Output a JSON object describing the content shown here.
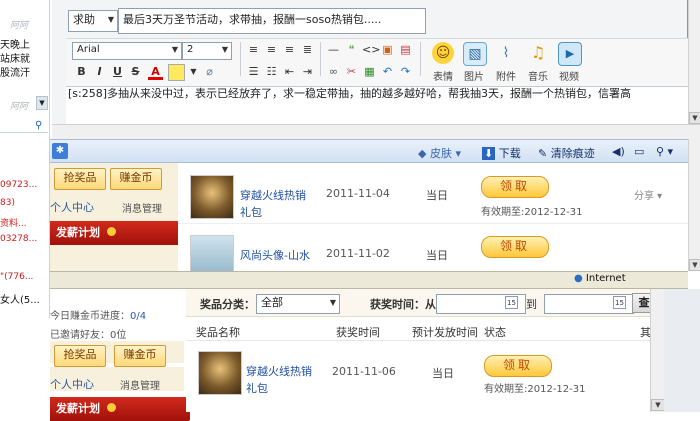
{
  "left_strip": {
    "lines_top": [
      "天晚上",
      "站床就",
      "股流汗"
    ],
    "faded_top": "阿阿",
    "faded_mid": "阿阿",
    "red_lines": [
      "09723...",
      "83)",
      "资料...",
      "03278...",
      "\"(776...",
      "女人(5..."
    ],
    "black_line": "女人(5..."
  },
  "editor": {
    "category_select": "求助",
    "subject": "最后3天万圣节活动，求带抽，报酬一soso热销包.....",
    "font_family": "Arial",
    "font_size": "2",
    "big_buttons": [
      {
        "icon": "smiley-icon",
        "label": "表情"
      },
      {
        "icon": "image-icon",
        "label": "图片"
      },
      {
        "icon": "attachment-icon",
        "label": "附件"
      },
      {
        "icon": "music-icon",
        "label": "音乐"
      },
      {
        "icon": "video-icon",
        "label": "视频"
      }
    ],
    "body_text": "[s:258]多抽从来没中过，表示已经放弃了，求一稳定带抽，抽的越多越好哈，帮我抽3天，报酬一个热销包，信署高"
  },
  "ie_toolbar": {
    "skin": "皮肤",
    "download": "下载",
    "clear_history": "清除痕迹"
  },
  "status_bar": {
    "zone": "Internet"
  },
  "middle_page": {
    "side_buttons": [
      "抢奖品",
      "赚金币"
    ],
    "personal_center": "个人中心",
    "message_manage": "消息管理",
    "salary_plan": "发薪计划",
    "rows": [
      {
        "title": "穿越火线热销礼包",
        "date": "2011-11-04",
        "status": "当日",
        "claim": "领取",
        "valid_label": "有效期至:",
        "valid_date": "2012-12-31",
        "share": "分享"
      },
      {
        "title": "风尚头像-山水",
        "date": "2011-11-02",
        "status": "当日",
        "claim": "领取"
      }
    ]
  },
  "bottom_page": {
    "level_text": "今日赚金币进度：",
    "level_value": "0/4",
    "invited_text": "已邀请好友：0位",
    "side_buttons": [
      "抢奖品",
      "赚金币"
    ],
    "personal_center": "个人中心",
    "message_manage": "消息管理",
    "salary_plan": "发薪计划",
    "filter": {
      "category_label": "奖品分类：",
      "category_value": "全部",
      "time_label": "获奖时间：从",
      "to_label": "到",
      "day_icon_text": "15",
      "search_button": "查"
    },
    "headers": [
      "奖品名称",
      "获奖时间",
      "预计发放时间",
      "状态",
      "其"
    ],
    "rows": [
      {
        "title": "穿越火线热销礼包",
        "date": "2011-11-06",
        "status": "当日",
        "claim": "领取",
        "valid_label": "有效期至:",
        "valid_date": "2012-12-31"
      }
    ]
  }
}
